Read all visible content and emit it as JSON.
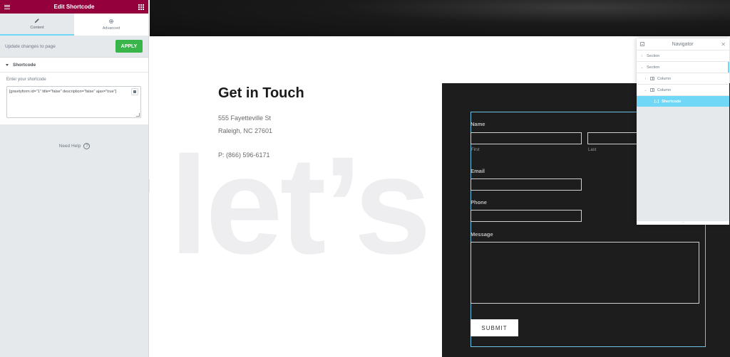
{
  "panel": {
    "title": "Edit Shortcode",
    "tabs": [
      {
        "label": "Content",
        "icon": "pencil-icon"
      },
      {
        "label": "Advanced",
        "icon": "gear-icon"
      }
    ],
    "update_label": "Update changes to page",
    "apply_label": "APPLY",
    "section_title": "Shortcode",
    "field_label": "Enter your shortcode",
    "shortcode_value": "[gravityform id=\"1\" title=\"false\" description=\"false\" ajax=\"true\"]",
    "need_help": "Need Help",
    "help_glyph": "?"
  },
  "canvas": {
    "background_text": "let’s c",
    "contact": {
      "title": "Get in Touch",
      "street": "555 Fayetteville St",
      "city": "Raleigh, NC 27601",
      "phone": "P: (866) 596-6171"
    },
    "form": {
      "name_label": "Name",
      "first_label": "First",
      "last_label": "Last",
      "email_label": "Email",
      "phone_label": "Phone",
      "message_label": "Message",
      "submit_label": "SUBMIT"
    }
  },
  "navigator": {
    "title": "Navigator",
    "items": [
      {
        "label": "Section"
      },
      {
        "label": "Section"
      },
      {
        "label": "Column"
      },
      {
        "label": "Column"
      },
      {
        "label": "Shortcode"
      }
    ],
    "footer_glyph": "⋯"
  },
  "colors": {
    "header": "#93003c",
    "apply": "#39b54a",
    "accent": "#71d7f7",
    "outline": "#6ec1e4"
  }
}
